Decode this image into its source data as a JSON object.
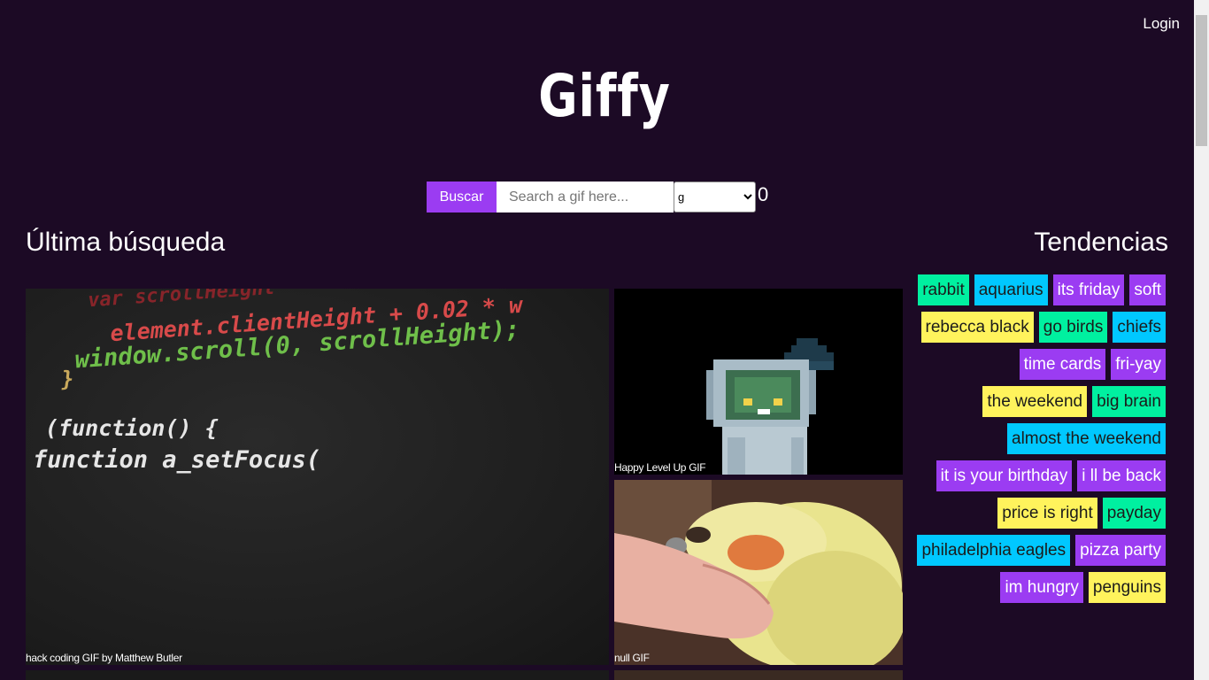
{
  "header": {
    "login_label": "Login",
    "logo_text": "Giffy"
  },
  "search": {
    "button_label": "Buscar",
    "placeholder": "Search a gif here...",
    "rating_selected": "g",
    "rating_options": [
      "g"
    ],
    "result_count": "0"
  },
  "sections": {
    "last_search_title": "Última búsqueda",
    "trending_title": "Tendencias"
  },
  "gifs": [
    {
      "caption": "hack coding GIF by Matthew Butler",
      "icon": "code-scroll-image"
    },
    {
      "caption": "Happy Level Up GIF",
      "icon": "pixel-robot-image"
    },
    {
      "caption": "null GIF",
      "icon": "cockatiel-bird-image"
    }
  ],
  "code_gif_text": {
    "line1": "var scrollHeight",
    "line2": "element.clientHeight + 0.02 * w",
    "line3": "window.scroll(0, scrollHeight);",
    "line4": "}",
    "line5": "(function() {",
    "line6": "function a_setFocus("
  },
  "trending": [
    {
      "label": "rabbit",
      "color": "#00f0a0"
    },
    {
      "label": "aquarius",
      "color": "#00c8ff"
    },
    {
      "label": "its friday",
      "color": "#9b3cf2"
    },
    {
      "label": "soft",
      "color": "#9b3cf2"
    },
    {
      "label": "rebecca black",
      "color": "#fff35c"
    },
    {
      "label": "go birds",
      "color": "#00f0a0"
    },
    {
      "label": "chiefs",
      "color": "#00c8ff"
    },
    {
      "label": "time cards",
      "color": "#9b3cf2"
    },
    {
      "label": "fri-yay",
      "color": "#9b3cf2"
    },
    {
      "label": "the weekend",
      "color": "#fff35c"
    },
    {
      "label": "big brain",
      "color": "#00f0a0"
    },
    {
      "label": "almost the weekend",
      "color": "#00c8ff"
    },
    {
      "label": "it is your birthday",
      "color": "#9b3cf2"
    },
    {
      "label": "i ll be back",
      "color": "#9b3cf2"
    },
    {
      "label": "price is right",
      "color": "#fff35c"
    },
    {
      "label": "payday",
      "color": "#00f0a0"
    },
    {
      "label": "philadelphia eagles",
      "color": "#00c8ff"
    },
    {
      "label": "pizza party",
      "color": "#9b3cf2"
    },
    {
      "label": "im hungry",
      "color": "#9b3cf2"
    },
    {
      "label": "penguins",
      "color": "#fff35c"
    }
  ],
  "colors": {
    "background": "#1c0a25",
    "accent": "#9b3cf2"
  }
}
